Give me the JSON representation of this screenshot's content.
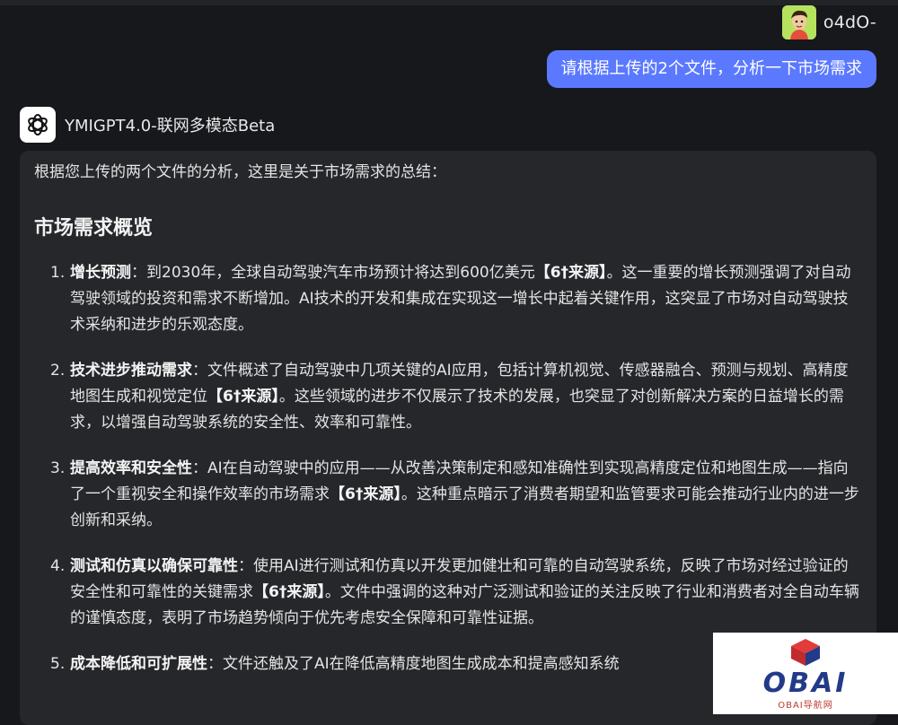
{
  "user": {
    "name": "o4dO-",
    "message": "请根据上传的2个文件，分析一下市场需求"
  },
  "assistant": {
    "name": "YMIGPT4.0-联网多模态Beta",
    "intro": "根据您上传的两个文件的分析，这里是关于市场需求的总结：",
    "section_title": "市场需求概览",
    "items": [
      {
        "num": "1.",
        "title": "增长预测",
        "text": "：到2030年，全球自动驾驶汽车市场预计将达到600亿美元",
        "citation": "【6†来源】",
        "rest": "。这一重要的增长预测强调了对自动驾驶领域的投资和需求不断增加。AI技术的开发和集成在实现这一增长中起着关键作用，这突显了市场对自动驾驶技术采纳和进步的乐观态度。"
      },
      {
        "num": "2.",
        "title": "技术进步推动需求",
        "text": "：文件概述了自动驾驶中几项关键的AI应用，包括计算机视觉、传感器融合、预测与规划、高精度地图生成和视觉定位",
        "citation": "【6†来源】",
        "rest": "。这些领域的进步不仅展示了技术的发展，也突显了对创新解决方案的日益增长的需求，以增强自动驾驶系统的安全性、效率和可靠性。"
      },
      {
        "num": "3.",
        "title": "提高效率和安全性",
        "text": "：AI在自动驾驶中的应用——从改善决策制定和感知准确性到实现高精度定位和地图生成——指向了一个重视安全和操作效率的市场需求",
        "citation": "【6†来源】",
        "rest": "。这种重点暗示了消费者期望和监管要求可能会推动行业内的进一步创新和采纳。"
      },
      {
        "num": "4.",
        "title": "测试和仿真以确保可靠性",
        "text": "：使用AI进行测试和仿真以开发更加健壮和可靠的自动驾驶系统，反映了市场对经过验证的安全性和可靠性的关键需求",
        "citation": "【6†来源】",
        "rest": "。文件中强调的这种对广泛测试和验证的关注反映了行业和消费者对全自动车辆的谨慎态度，表明了市场趋势倾向于优先考虑安全保障和可靠性证据。"
      },
      {
        "num": "5.",
        "title": "成本降低和可扩展性",
        "text": "：文件还触及了AI在降低高精度地图生成成本和提高感知系统",
        "citation": "",
        "rest": ""
      }
    ]
  },
  "watermark": {
    "text": "OBAI",
    "subtitle": "OBAI导航网"
  },
  "colors": {
    "background": "#17181c",
    "card": "#26272b",
    "user_bubble": "#5b79ff",
    "avatar_bg": "#b6e35d"
  }
}
